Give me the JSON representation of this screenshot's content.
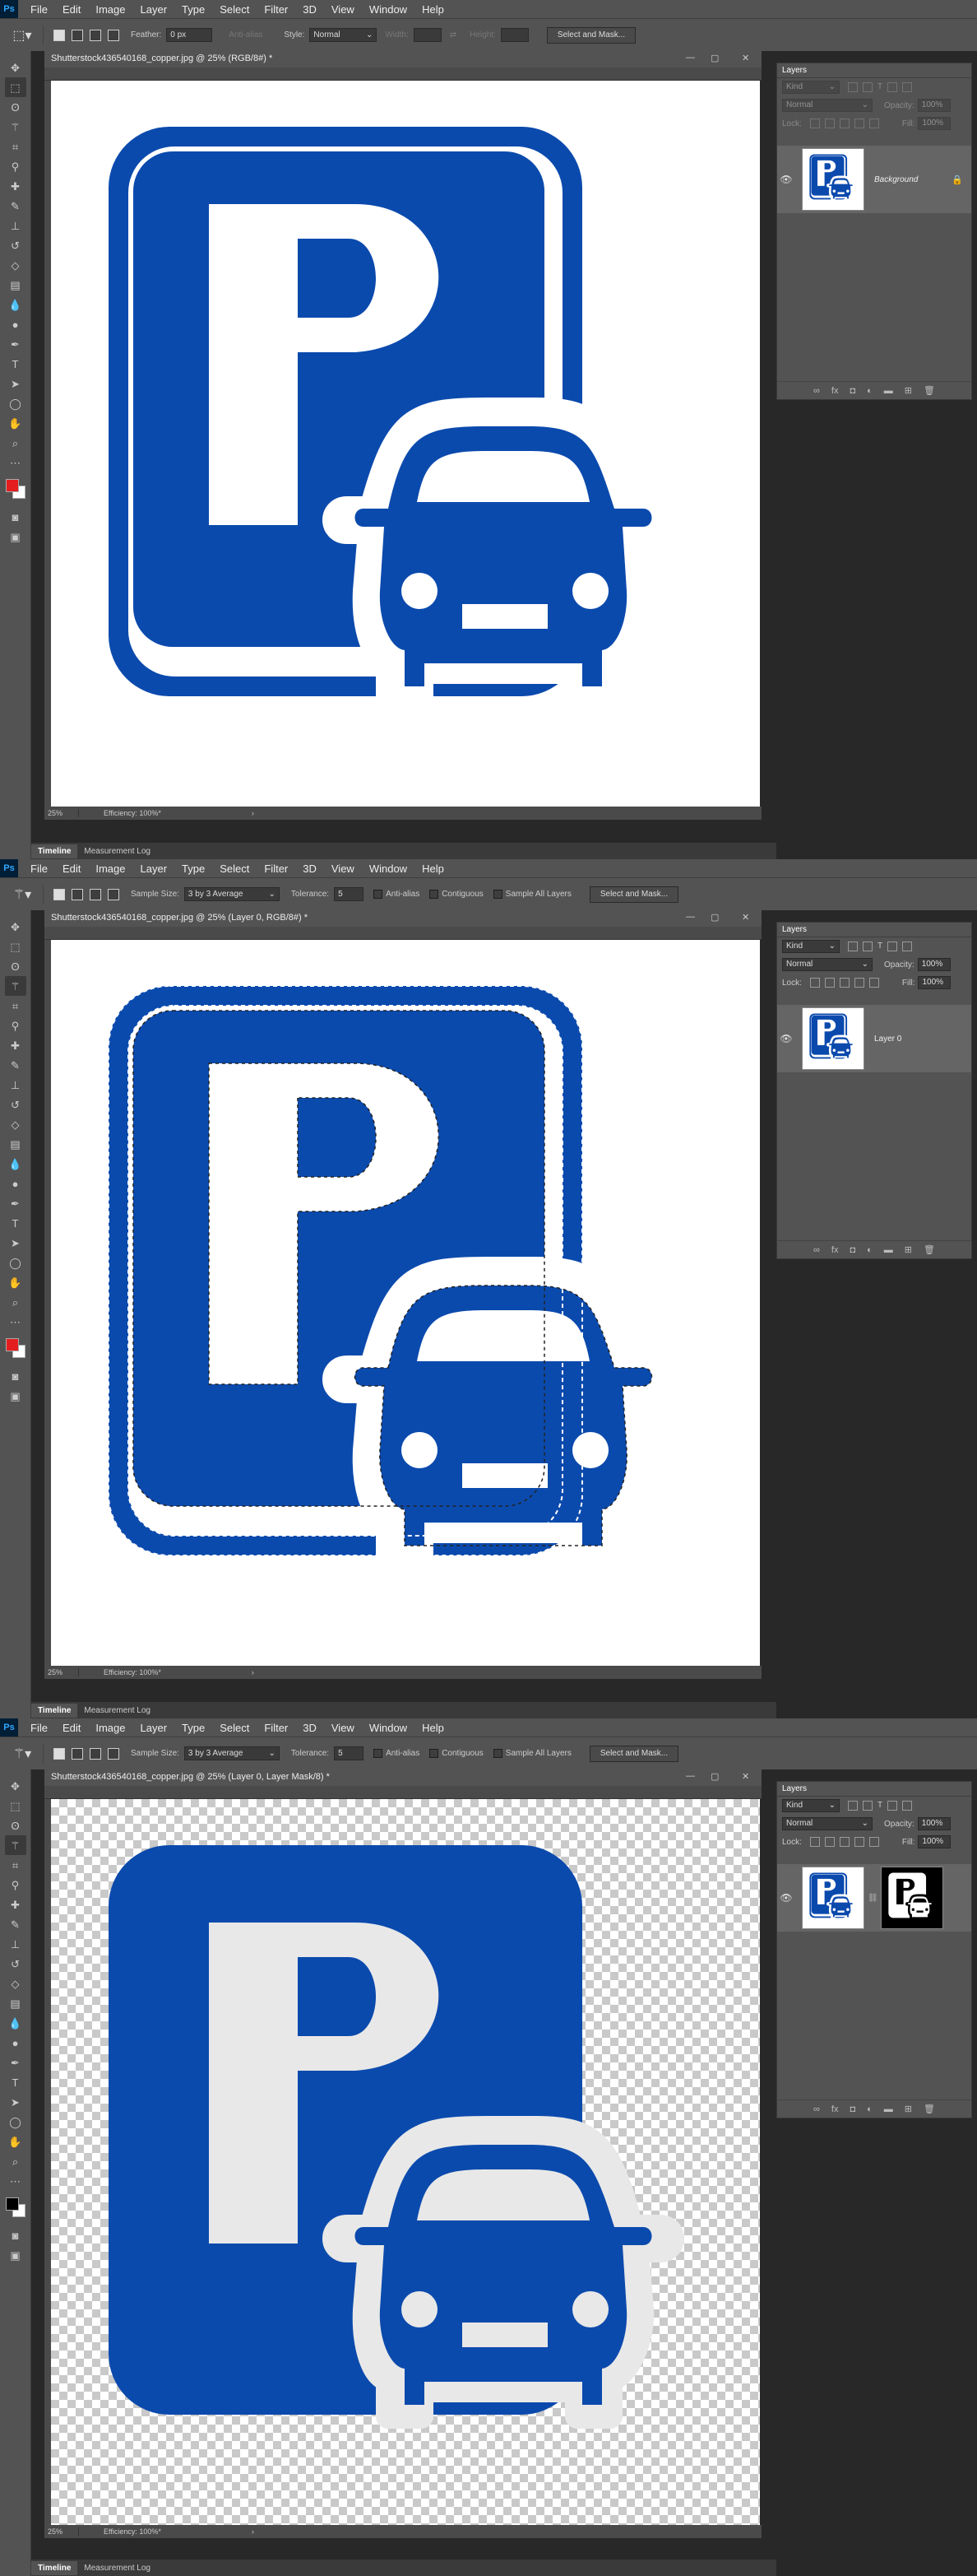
{
  "menu": {
    "logo": "Ps",
    "items": [
      "File",
      "Edit",
      "Image",
      "Layer",
      "Type",
      "Select",
      "Filter",
      "3D",
      "View",
      "Window",
      "Help"
    ]
  },
  "window_controls": {
    "minimize": "—",
    "restore": "▢",
    "close": "✕"
  },
  "colors": {
    "sign_blue": "#0b4aad",
    "ui_gray": "#535353",
    "dark_gray": "#282828",
    "accent_red": "#e41e1e"
  },
  "icons": [
    "move-icon",
    "marquee-icon",
    "lasso-icon",
    "magic-wand-icon",
    "crop-icon",
    "eyedropper-icon",
    "healing-brush-icon",
    "brush-icon",
    "clone-stamp-icon",
    "history-brush-icon",
    "eraser-icon",
    "gradient-icon",
    "blur-icon",
    "dodge-icon",
    "pen-icon",
    "type-icon",
    "path-selection-icon",
    "shape-icon",
    "hand-icon",
    "zoom-icon",
    "more-tools-icon",
    "edit-quick-mask-icon",
    "screen-mode-icon"
  ],
  "screens": [
    {
      "options": {
        "tool": "rectangular-marquee",
        "feather_label": "Feather:",
        "feather_value": "0 px",
        "antialias_label": "Anti-alias",
        "style_label": "Style:",
        "style_value": "Normal",
        "width_label": "Width:",
        "height_label": "Height:",
        "button": "Select and Mask..."
      },
      "doc_title": "Shutterstock436540168_copper.jpg @ 25% (RGB/8#) *",
      "zoom": "25%",
      "efficiency": "Efficiency: 100%*",
      "tabs": [
        "Timeline",
        "Measurement Log"
      ],
      "layers": {
        "title": "Layers",
        "kind": "Kind",
        "blend": "Normal",
        "opacity_label": "Opacity:",
        "opacity": "100%",
        "lock_label": "Lock:",
        "fill_label": "Fill:",
        "fill": "100%",
        "layer_name": "Background",
        "has_mask": false,
        "background_locked": true
      },
      "canvas": "white",
      "selection": false,
      "fg_color": "#e41e1e"
    },
    {
      "options": {
        "tool": "magic-wand",
        "sample_size_label": "Sample Size:",
        "sample_size": "3 by 3 Average",
        "tolerance_label": "Tolerance:",
        "tolerance": "5",
        "antialias_label": "Anti-alias",
        "contiguous_label": "Contiguous",
        "sample_all_label": "Sample All Layers",
        "button": "Select and Mask..."
      },
      "doc_title": "Shutterstock436540168_copper.jpg @ 25% (Layer 0, RGB/8#) *",
      "zoom": "25%",
      "efficiency": "Efficiency: 100%*",
      "tabs": [
        "Timeline",
        "Measurement Log"
      ],
      "layers": {
        "title": "Layers",
        "kind": "Kind",
        "blend": "Normal",
        "opacity_label": "Opacity:",
        "opacity": "100%",
        "lock_label": "Lock:",
        "fill_label": "Fill:",
        "fill": "100%",
        "layer_name": "Layer 0",
        "has_mask": false,
        "background_locked": false
      },
      "canvas": "white",
      "selection": true,
      "fg_color": "#e41e1e"
    },
    {
      "options": {
        "tool": "magic-wand",
        "sample_size_label": "Sample Size:",
        "sample_size": "3 by 3 Average",
        "tolerance_label": "Tolerance:",
        "tolerance": "5",
        "antialias_label": "Anti-alias",
        "contiguous_label": "Contiguous",
        "sample_all_label": "Sample All Layers",
        "button": "Select and Mask..."
      },
      "doc_title": "Shutterstock436540168_copper.jpg @ 25% (Layer 0, Layer Mask/8) *",
      "zoom": "25%",
      "efficiency": "Efficiency: 100%*",
      "tabs": [
        "Timeline",
        "Measurement Log"
      ],
      "layers": {
        "title": "Layers",
        "kind": "Kind",
        "blend": "Normal",
        "opacity_label": "Opacity:",
        "opacity": "100%",
        "lock_label": "Lock:",
        "fill_label": "Fill:",
        "fill": "100%",
        "layer_name": "",
        "has_mask": true,
        "background_locked": false
      },
      "canvas": "checker",
      "selection": false,
      "fg_color": "#000000"
    }
  ]
}
